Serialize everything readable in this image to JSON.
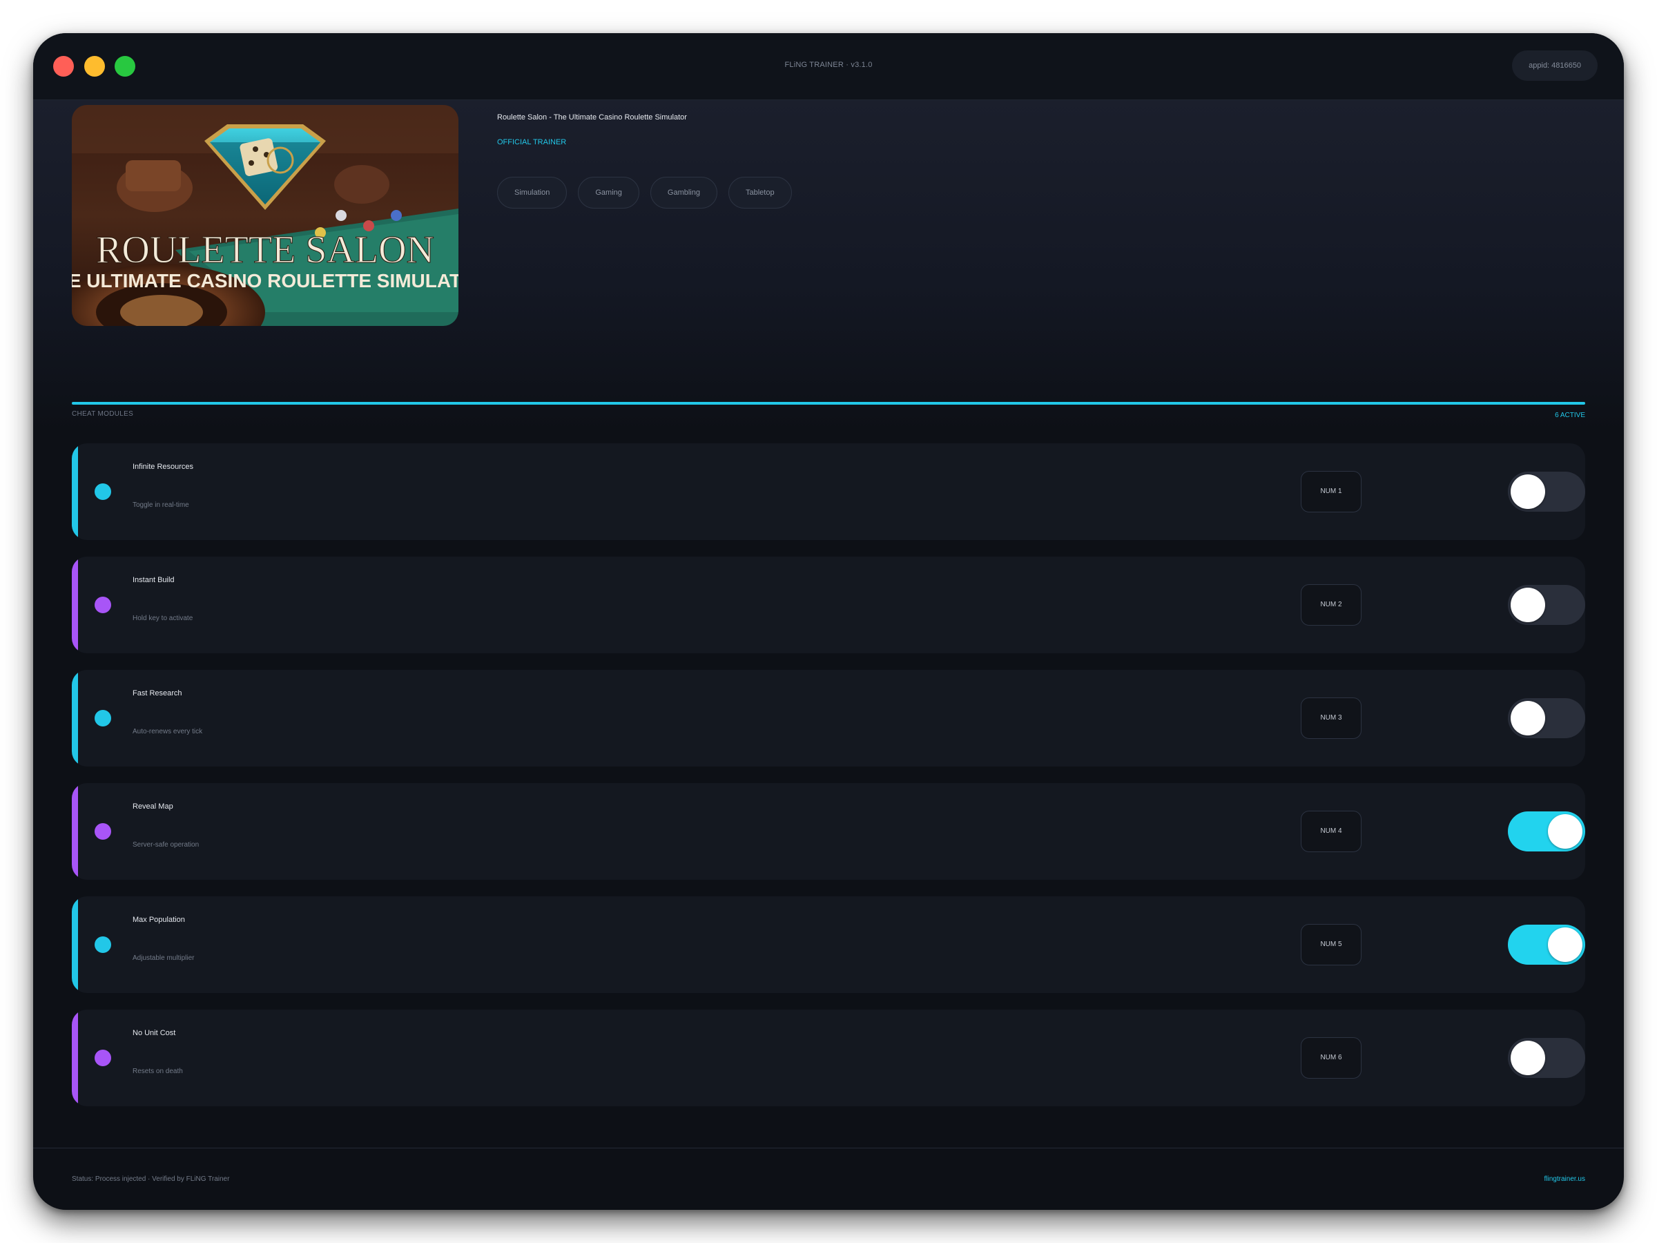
{
  "window": {
    "title": "FLiNG TRAINER · v3.1.0",
    "appid": "appid: 4816650"
  },
  "game": {
    "title": "Roulette Salon - The Ultimate Casino Roulette Simulator",
    "badge": "OFFICIAL TRAINER",
    "tags": [
      "Simulation",
      "Gaming",
      "Gambling",
      "Tabletop"
    ],
    "cover": {
      "title": "ROULETTE SALON",
      "subtitle": "HE ULTIMATE CASINO ROULETTE SIMULATO"
    }
  },
  "modules": {
    "label": "CHEAT MODULES",
    "active_count": "6 ACTIVE",
    "items": [
      {
        "name": "Infinite Resources",
        "desc": "Toggle in real-time",
        "key": "NUM 1",
        "enabled": false,
        "accent": "#22c7e8"
      },
      {
        "name": "Instant Build",
        "desc": "Hold key to activate",
        "key": "NUM 2",
        "enabled": false,
        "accent": "#a855f7"
      },
      {
        "name": "Fast Research",
        "desc": "Auto-renews every tick",
        "key": "NUM 3",
        "enabled": false,
        "accent": "#22c7e8"
      },
      {
        "name": "Reveal Map",
        "desc": "Server-safe operation",
        "key": "NUM 4",
        "enabled": true,
        "accent": "#a855f7"
      },
      {
        "name": "Max Population",
        "desc": "Adjustable multiplier",
        "key": "NUM 5",
        "enabled": true,
        "accent": "#22c7e8"
      },
      {
        "name": "No Unit Cost",
        "desc": "Resets on death",
        "key": "NUM 6",
        "enabled": false,
        "accent": "#a855f7"
      }
    ]
  },
  "footer": {
    "status": "Status: Process injected · Verified by FLiNG Trainer",
    "link": "flingtrainer.us"
  },
  "colors": {
    "accent_cyan": "#22c7e8",
    "accent_purple": "#a855f7",
    "toggle_on": "#22d3ee",
    "toggle_off": "#2a2f3b"
  }
}
